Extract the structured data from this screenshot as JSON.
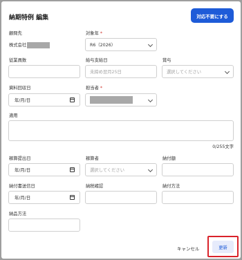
{
  "dialog": {
    "title": "納期特例 編集",
    "header_button": "対応不要にする"
  },
  "fields": {
    "client": {
      "label": "顧問先",
      "value_prefix": "株式会社"
    },
    "target_year": {
      "label": "対象年",
      "required_mark": "*",
      "value": "R6（2026）"
    },
    "employees": {
      "label": "従業員数",
      "value": ""
    },
    "payday": {
      "label": "給与支給日",
      "placeholder": "未締め翌月25日"
    },
    "bonus": {
      "label": "賞与",
      "placeholder": "選択してください"
    },
    "doc_collection_date": {
      "label": "資料回収日",
      "value": "年/月/日"
    },
    "assignee": {
      "label": "担当者",
      "required_mark": "*"
    },
    "remarks": {
      "label": "適用",
      "value": "",
      "counter": "0/255文字"
    },
    "calc_submit_date": {
      "label": "稼算提出日",
      "value": "年/月/日"
    },
    "calculator": {
      "label": "稼算者",
      "placeholder": "選択してください"
    },
    "payment_amount": {
      "label": "納付額",
      "value": ""
    },
    "payment_slip_date": {
      "label": "納付書送信日",
      "value": "年/月/日"
    },
    "tax_confirm": {
      "label": "納税確認",
      "value": ""
    },
    "payment_method": {
      "label": "納付方法",
      "value": ""
    },
    "delivery_method": {
      "label": "納品方法",
      "value": ""
    }
  },
  "footer": {
    "cancel": "キャンセル",
    "update": "更新"
  },
  "colors": {
    "primary": "#1e5bd8",
    "highlight_border": "#d9222a",
    "required": "#d0332b"
  }
}
